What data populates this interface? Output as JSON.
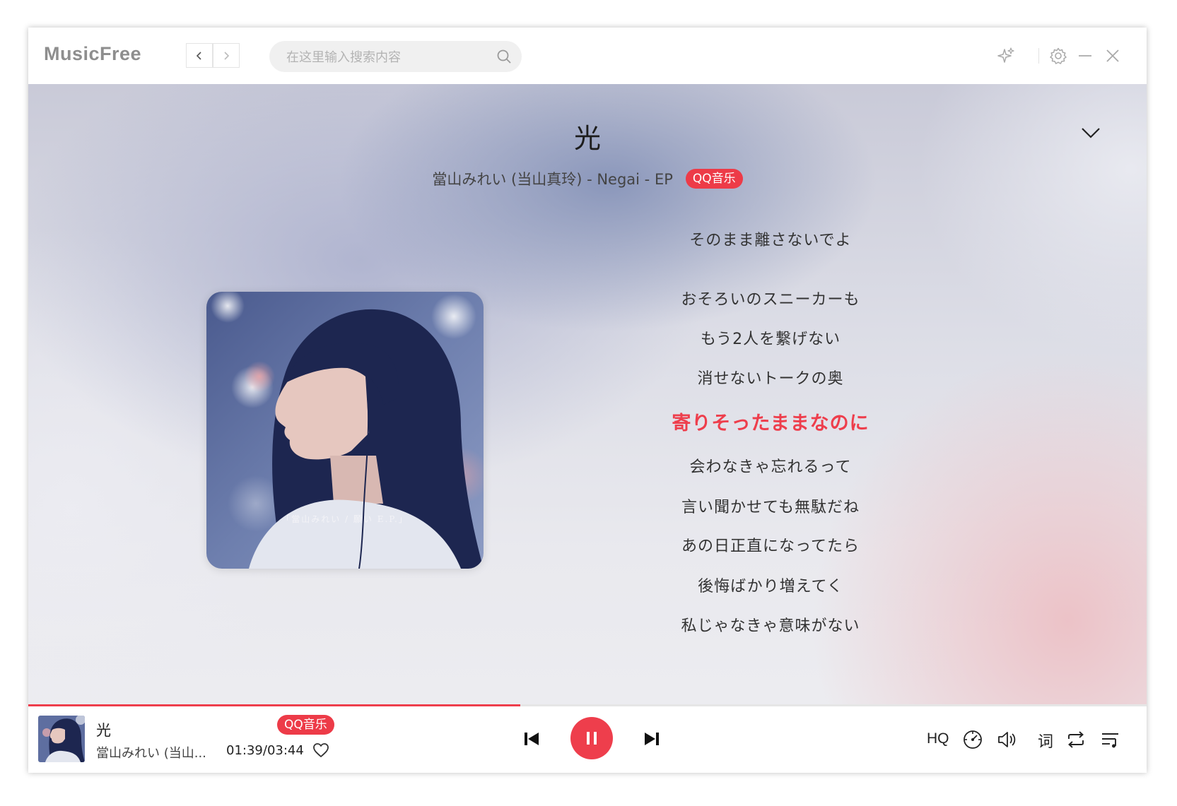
{
  "app": {
    "name": "MusicFree"
  },
  "search": {
    "placeholder": "在这里输入搜索内容"
  },
  "now_playing": {
    "title": "光",
    "subtitle": "當山みれい (当山真玲) - Negai - EP",
    "source": "QQ音乐",
    "album_caption": "「當山みれい / 願い E.P.」"
  },
  "lyrics": [
    {
      "text": "そのまま離さないでよ",
      "active": false
    },
    {
      "text": "おそろいのスニーカーも",
      "active": false
    },
    {
      "text": "もう2人を繋げない",
      "active": false
    },
    {
      "text": "消せないトークの奥",
      "active": false
    },
    {
      "text": "寄りそったままなのに",
      "active": true
    },
    {
      "text": "会わなきゃ忘れるって",
      "active": false
    },
    {
      "text": "言い聞かせても無駄だね",
      "active": false
    },
    {
      "text": "あの日正直になってたら",
      "active": false
    },
    {
      "text": "後悔ばかり増えてく",
      "active": false
    },
    {
      "text": "私じゃなきゃ意味がない",
      "active": false
    }
  ],
  "player": {
    "title": "光",
    "artist": "當山みれい (当山...",
    "source": "QQ音乐",
    "time": "01:39/03:44",
    "progress": 0.44,
    "quality": "HQ",
    "lyric_toggle": "词"
  },
  "colors": {
    "accent": "#ee3e4c",
    "text": "#333333"
  },
  "icons": {
    "search": "search-icon",
    "theme": "sparkle-icon",
    "settings": "gear-icon",
    "minimize": "minimize-icon",
    "close": "close-icon",
    "collapse": "chevron-down-icon",
    "prev": "skip-previous-icon",
    "pause": "pause-icon",
    "next": "skip-next-icon",
    "heart": "heart-icon",
    "speed": "gauge-icon",
    "volume": "volume-icon",
    "repeat": "repeat-icon",
    "playlist": "playlist-icon"
  }
}
